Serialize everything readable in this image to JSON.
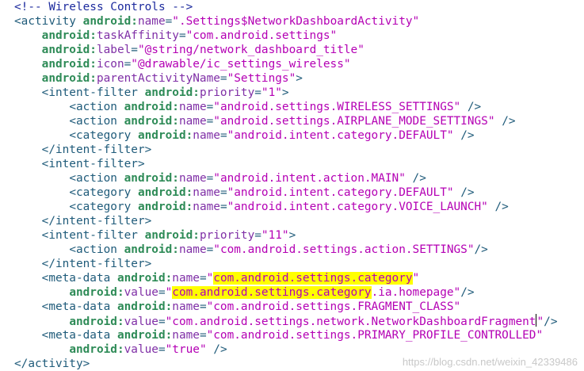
{
  "lines": [
    {
      "text": "<!-- Wireless Controls -->"
    },
    {
      "text": "<activity android:name=\".Settings$NetworkDashboardActivity\""
    },
    {
      "text": "    android:taskAffinity=\"com.android.settings\""
    },
    {
      "text": "    android:label=\"@string/network_dashboard_title\""
    },
    {
      "text": "    android:icon=\"@drawable/ic_settings_wireless\""
    },
    {
      "text": "    android:parentActivityName=\"Settings\">"
    },
    {
      "text": "    <intent-filter android:priority=\"1\">"
    },
    {
      "text": "        <action android:name=\"android.settings.WIRELESS_SETTINGS\" />"
    },
    {
      "text": "        <action android:name=\"android.settings.AIRPLANE_MODE_SETTINGS\" />"
    },
    {
      "text": "        <category android:name=\"android.intent.category.DEFAULT\" />"
    },
    {
      "text": "    </intent-filter>"
    },
    {
      "text": "    <intent-filter>"
    },
    {
      "text": "        <action android:name=\"android.intent.action.MAIN\" />"
    },
    {
      "text": "        <category android:name=\"android.intent.category.DEFAULT\" />"
    },
    {
      "text": "        <category android:name=\"android.intent.category.VOICE_LAUNCH\" />"
    },
    {
      "text": "    </intent-filter>"
    },
    {
      "text": "    <intent-filter android:priority=\"11\">"
    },
    {
      "text": "        <action android:name=\"com.android.settings.action.SETTINGS\"/>"
    },
    {
      "text": "    </intent-filter>"
    },
    {
      "text": "    <meta-data android:name=\"com.android.settings.category\""
    },
    {
      "text": "        android:value=\"com.android.settings.category.ia.homepage\"/>"
    },
    {
      "text": "    <meta-data android:name=\"com.android.settings.FRAGMENT_CLASS\""
    },
    {
      "text": "        android:value=\"com.android.settings.network.NetworkDashboardFragment\"/>"
    },
    {
      "text": "    <meta-data android:name=\"com.android.settings.PRIMARY_PROFILE_CONTROLLED\""
    },
    {
      "text": "        android:value=\"true\" />"
    },
    {
      "text": "</activity>"
    }
  ],
  "highlights": [
    "com.android.settings.category"
  ],
  "colors": {
    "comment": "#1d2b9e",
    "tag": "#1f5b7a",
    "namespace": "#2e8b57",
    "attribute": "#7f2fa6",
    "string": "#b400b4",
    "highlight": "#ffff00"
  },
  "watermark": "https://blog.csdn.net/weixin_42339486"
}
